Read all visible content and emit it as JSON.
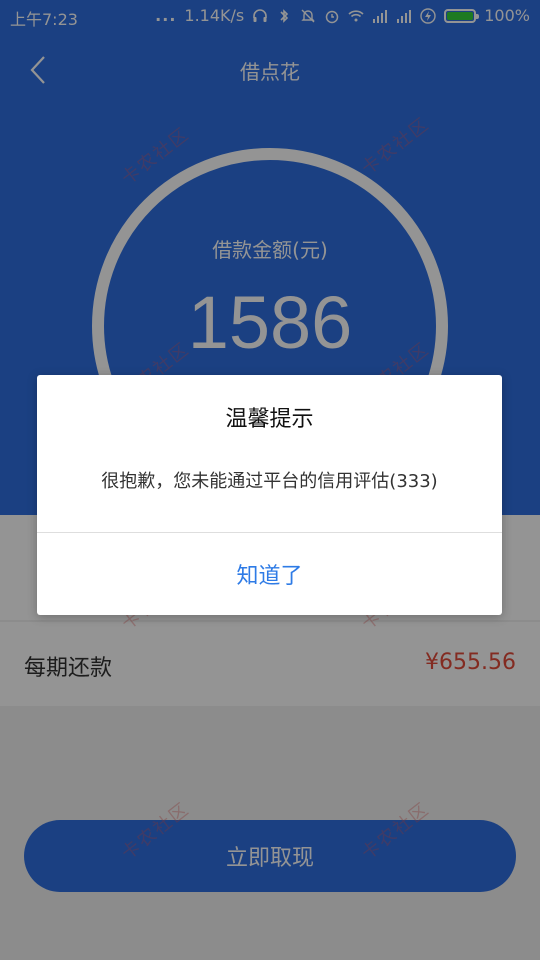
{
  "status_bar": {
    "time": "上午7:23",
    "dots": "...",
    "network_speed": "1.14K/s",
    "battery_percent": "100%",
    "icons": [
      "headphones-icon",
      "bluetooth-icon",
      "mute-icon",
      "alarm-icon",
      "wifi-icon",
      "signal-icon",
      "signal-icon",
      "charging-icon",
      "battery-icon"
    ]
  },
  "header": {
    "back_icon": "chevron-left-icon",
    "title": "借点花"
  },
  "loan": {
    "amount_label": "借款金额(元)",
    "amount_value": "1586"
  },
  "repayment": {
    "per_period_label": "每期还款",
    "per_period_value": "¥655.56"
  },
  "cta": {
    "label": "立即取现"
  },
  "watermark": {
    "text": "卡农社区"
  },
  "dialog": {
    "title": "温馨提示",
    "message": "很抱歉，您未能通过平台的信用评估(333)",
    "confirm_label": "知道了"
  },
  "colors": {
    "brand_blue": "#2f6fe0",
    "link_blue": "#2e7be6",
    "price_red": "#e24a3a",
    "battery_green": "#35d33a"
  }
}
